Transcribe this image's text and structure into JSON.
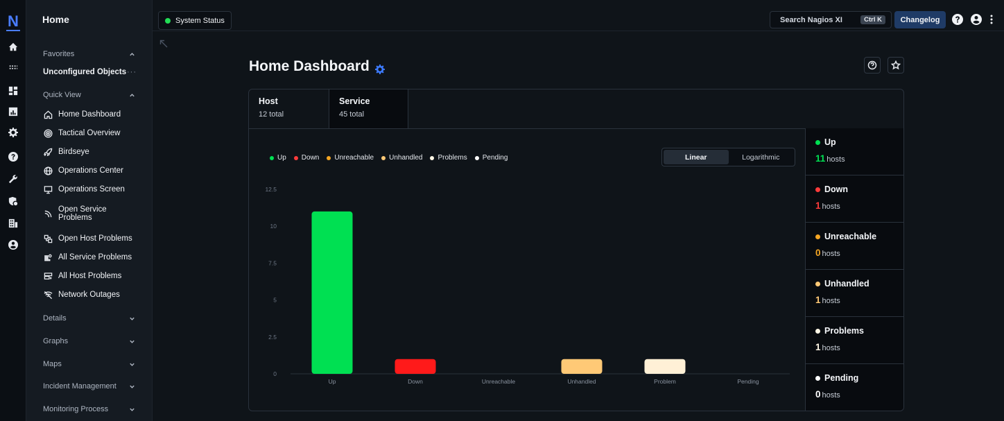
{
  "app": {
    "logo": "N",
    "sidebar_title": "Home"
  },
  "topbar": {
    "status_label": "System Status",
    "search_placeholder": "Search Nagios XI",
    "search_shortcut": "Ctrl K",
    "changelog_label": "Changelog"
  },
  "sidebar": {
    "favorites_label": "Favorites",
    "unconfigured_label": "Unconfigured Objects",
    "unconfigured_more": "···",
    "quickview_label": "Quick View",
    "items": [
      {
        "label": "Home Dashboard",
        "icon": "home-icon"
      },
      {
        "label": "Tactical Overview",
        "icon": "target-icon"
      },
      {
        "label": "Birdseye",
        "icon": "rocket-icon"
      },
      {
        "label": "Operations Center",
        "icon": "globe-icon"
      },
      {
        "label": "Operations Screen",
        "icon": "monitor-icon"
      },
      {
        "label": "Open Service Problems",
        "icon": "rss-icon"
      },
      {
        "label": "Open Host Problems",
        "icon": "network-icon"
      },
      {
        "label": "All Service Problems",
        "icon": "grid-alert-icon"
      },
      {
        "label": "All Host Problems",
        "icon": "server-icon"
      },
      {
        "label": "Network Outages",
        "icon": "wifi-off-icon"
      }
    ],
    "sections": [
      {
        "label": "Details"
      },
      {
        "label": "Graphs"
      },
      {
        "label": "Maps"
      },
      {
        "label": "Incident Management"
      },
      {
        "label": "Monitoring Process"
      }
    ]
  },
  "main": {
    "title": "Home Dashboard",
    "tabs": [
      {
        "label": "Host",
        "sub": "12 total"
      },
      {
        "label": "Service",
        "sub": "45 total"
      }
    ],
    "scale": {
      "linear": "Linear",
      "logarithmic": "Logarithmic",
      "active": "Linear"
    }
  },
  "colors": {
    "up": "#00e052",
    "down": "#ff1a1a",
    "unreachable": "#f5a623",
    "unhandled": "#ffc976",
    "problems": "#fff0d6",
    "pending": "#ffffff",
    "accent": "#3d7bff"
  },
  "legend": [
    {
      "label": "Up",
      "color": "#00e052"
    },
    {
      "label": "Down",
      "color": "#ff3b3b"
    },
    {
      "label": "Unreachable",
      "color": "#f5a623"
    },
    {
      "label": "Unhandled",
      "color": "#ffc976"
    },
    {
      "label": "Problems",
      "color": "#fff7e6"
    },
    {
      "label": "Pending",
      "color": "#ffffff"
    }
  ],
  "chart_data": {
    "type": "bar",
    "categories": [
      "Up",
      "Down",
      "Unreachable",
      "Unhandled",
      "Problem",
      "Pending"
    ],
    "values": [
      11,
      1,
      0,
      1,
      1,
      0
    ],
    "colors": [
      "#00e052",
      "#ff1a1a",
      "#f5a623",
      "#ffc976",
      "#fff0d6",
      "#ffffff"
    ],
    "yticks": [
      "0",
      "2.5",
      "5",
      "7.5",
      "10",
      "12.5"
    ],
    "ylim": [
      0,
      12.5
    ],
    "grid": false
  },
  "stats": [
    {
      "label": "Up",
      "value": "11",
      "unit": "hosts",
      "color": "#00e052"
    },
    {
      "label": "Down",
      "value": "1",
      "unit": "hosts",
      "color": "#ff3b3b"
    },
    {
      "label": "Unreachable",
      "value": "0",
      "unit": "hosts",
      "color": "#f5a623"
    },
    {
      "label": "Unhandled",
      "value": "1",
      "unit": "hosts",
      "color": "#ffc976"
    },
    {
      "label": "Problems",
      "value": "1",
      "unit": "hosts",
      "color": "#fff7e6"
    },
    {
      "label": "Pending",
      "value": "0",
      "unit": "hosts",
      "color": "#ffffff"
    }
  ]
}
